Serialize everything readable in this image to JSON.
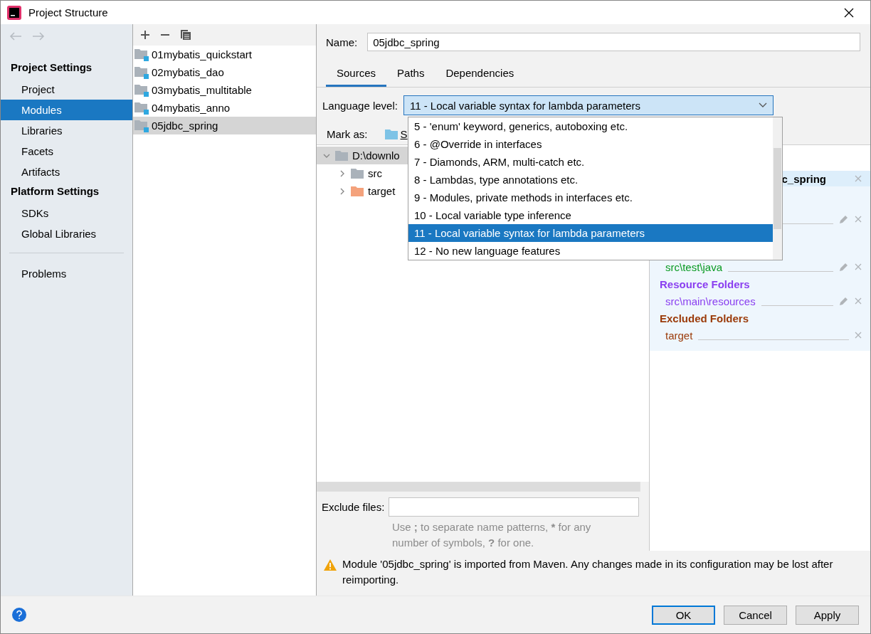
{
  "window": {
    "title": "Project Structure"
  },
  "sidebar": {
    "sections": [
      {
        "title": "Project Settings",
        "items": [
          {
            "label": "Project",
            "selected": false
          },
          {
            "label": "Modules",
            "selected": true
          },
          {
            "label": "Libraries",
            "selected": false
          },
          {
            "label": "Facets",
            "selected": false
          },
          {
            "label": "Artifacts",
            "selected": false
          }
        ]
      },
      {
        "title": "Platform Settings",
        "items": [
          {
            "label": "SDKs",
            "selected": false
          },
          {
            "label": "Global Libraries",
            "selected": false
          }
        ]
      }
    ],
    "footer_items": [
      {
        "label": "Problems",
        "selected": false
      }
    ]
  },
  "modules": [
    {
      "name": "01mybatis_quickstart",
      "selected": false
    },
    {
      "name": "02mybatis_dao",
      "selected": false
    },
    {
      "name": "03mybatis_multitable",
      "selected": false
    },
    {
      "name": "04mybatis_anno",
      "selected": false
    },
    {
      "name": "05jdbc_spring",
      "selected": true
    }
  ],
  "name_field": {
    "label": "Name:",
    "value": "05jdbc_spring"
  },
  "tabs": [
    {
      "label": "Sources",
      "selected": true
    },
    {
      "label": "Paths",
      "selected": false
    },
    {
      "label": "Dependencies",
      "selected": false
    }
  ],
  "language_level": {
    "label": "Language level:",
    "value": "11 - Local variable syntax for lambda parameters",
    "expanded": true,
    "options": [
      {
        "label": "5 - 'enum' keyword, generics, autoboxing etc.",
        "selected": false
      },
      {
        "label": "6 - @Override in interfaces",
        "selected": false
      },
      {
        "label": "7 - Diamonds, ARM, multi-catch etc.",
        "selected": false
      },
      {
        "label": "8 - Lambdas, type annotations etc.",
        "selected": false
      },
      {
        "label": "9 - Modules, private methods in interfaces etc.",
        "selected": false
      },
      {
        "label": "10 - Local variable type inference",
        "selected": false
      },
      {
        "label": "11 - Local variable syntax for lambda parameters",
        "selected": true
      },
      {
        "label": "12 - No new language features",
        "selected": false
      }
    ]
  },
  "mark_as": {
    "label": "Mark as:",
    "button": "S"
  },
  "tree": [
    {
      "label": "D:\\downlo",
      "excluded": false,
      "selected": true,
      "expanded": true,
      "children": [
        {
          "label": "src",
          "excluded": false,
          "selected": false,
          "expanded": false
        },
        {
          "label": "target",
          "excluded": true,
          "selected": false,
          "expanded": false
        }
      ]
    }
  ],
  "exclude_files": {
    "label": "Exclude files:",
    "hint": "Use **;** to separate name patterns, ***** for any number of symbols, **?** for one."
  },
  "roots_panel": {
    "root": "c_spring",
    "groups": [
      {
        "paths": [
          {
            "editable": true
          }
        ]
      },
      {
        "color": "#0a9a22",
        "paths": [
          {
            "path": "src\\test\\java",
            "editable": true
          }
        ]
      },
      {
        "title": "Resource Folders",
        "color": "#8a3ff0",
        "paths": [
          {
            "path": "src\\main\\resources",
            "editable": true
          }
        ]
      },
      {
        "title": "Excluded Folders",
        "color": "#9b3b0a",
        "paths": [
          {
            "path": "target",
            "editable": false
          }
        ]
      }
    ]
  },
  "warning": "Module '05jdbc_spring' is imported from Maven. Any changes made in its configuration may be lost after reimporting.",
  "buttons": [
    {
      "label": "OK",
      "default": true
    },
    {
      "label": "Cancel",
      "default": false
    },
    {
      "label": "Apply",
      "default": false
    }
  ]
}
